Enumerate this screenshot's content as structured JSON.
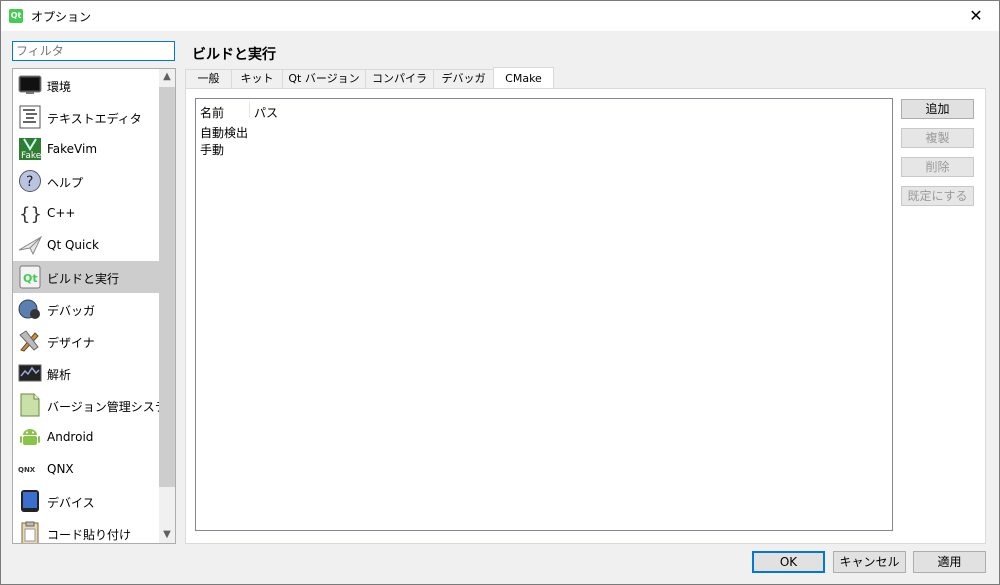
{
  "window": {
    "title": "オプション",
    "app_icon_text": "Qt",
    "close_glyph": "✕"
  },
  "filter": {
    "placeholder": "フィルタ",
    "value": ""
  },
  "sidebar": {
    "items": [
      {
        "label": "環境",
        "icon": "monitor-icon"
      },
      {
        "label": "テキストエディタ",
        "icon": "text-editor-icon"
      },
      {
        "label": "FakeVim",
        "icon": "fakevim-icon"
      },
      {
        "label": "ヘルプ",
        "icon": "help-icon"
      },
      {
        "label": "C++",
        "icon": "braces-icon"
      },
      {
        "label": "Qt Quick",
        "icon": "paper-plane-icon"
      },
      {
        "label": "ビルドと実行",
        "icon": "build-run-icon",
        "selected": true
      },
      {
        "label": "デバッガ",
        "icon": "debugger-icon"
      },
      {
        "label": "デザイナ",
        "icon": "designer-icon"
      },
      {
        "label": "解析",
        "icon": "analyzer-icon"
      },
      {
        "label": "バージョン管理システム",
        "icon": "version-control-icon"
      },
      {
        "label": "Android",
        "icon": "android-icon"
      },
      {
        "label": "QNX",
        "icon": "qnx-icon"
      },
      {
        "label": "デバイス",
        "icon": "device-icon"
      },
      {
        "label": "コード貼り付け",
        "icon": "code-paste-icon"
      }
    ],
    "scroll_up": "▲",
    "scroll_down": "▼"
  },
  "page": {
    "title": "ビルドと実行",
    "tabs": [
      {
        "label": "一般"
      },
      {
        "label": "キット"
      },
      {
        "label": "Qt バージョン"
      },
      {
        "label": "コンパイラ"
      },
      {
        "label": "デバッガ"
      },
      {
        "label": "CMake",
        "active": true
      }
    ]
  },
  "cmake": {
    "columns": {
      "name": "名前",
      "path": "パス"
    },
    "rows": [
      "自動検出",
      "手動"
    ],
    "buttons": {
      "add": "追加",
      "clone": "複製",
      "remove": "削除",
      "make_default": "既定にする"
    }
  },
  "footer": {
    "ok": "OK",
    "cancel": "キャンセル",
    "apply": "適用"
  },
  "colors": {
    "accent": "#0078d7",
    "selected_bg": "#cdcdcd",
    "qt_green": "#41cd52"
  }
}
